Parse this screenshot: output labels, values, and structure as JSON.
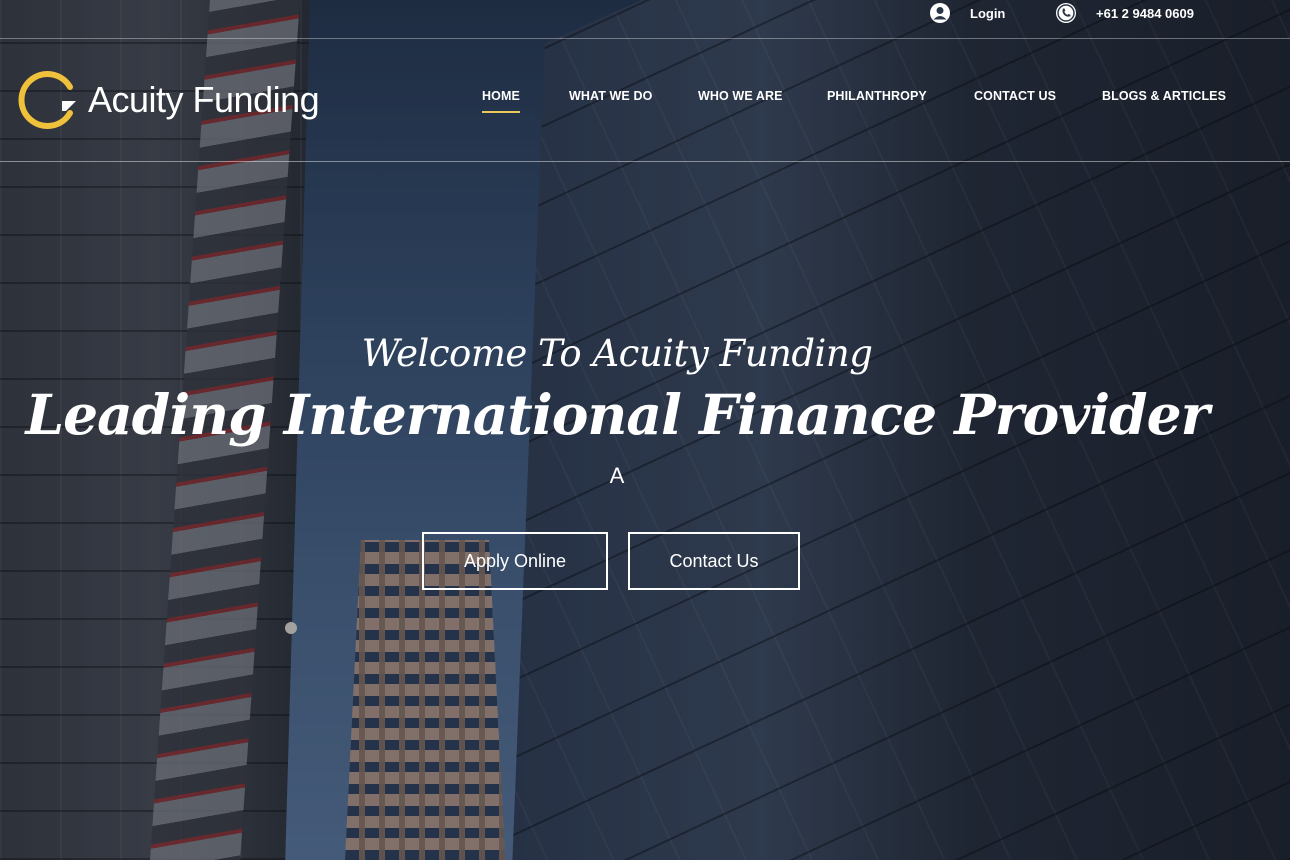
{
  "topbar": {
    "login_label": "Login",
    "phone": "+61 2 9484 0609",
    "icons": [
      "user-icon",
      "phone-icon"
    ]
  },
  "brand": {
    "name": "Acuity Funding",
    "accent_color": "#f0c13a"
  },
  "nav": {
    "items": [
      {
        "label": "HOME",
        "active": true
      },
      {
        "label": "WHAT WE DO",
        "active": false
      },
      {
        "label": "WHO WE ARE",
        "active": false
      },
      {
        "label": "PHILANTHROPY",
        "active": false
      },
      {
        "label": "CONTACT US",
        "active": false
      },
      {
        "label": "BLOGS & ARTICLES",
        "active": false
      }
    ],
    "active_underline_color": "#e8c95a"
  },
  "hero": {
    "kicker": "Welcome To Acuity Funding",
    "title": "Leading International Finance Provider",
    "sub": "A",
    "buttons": {
      "apply": "Apply Online",
      "contact": "Contact Us"
    }
  }
}
